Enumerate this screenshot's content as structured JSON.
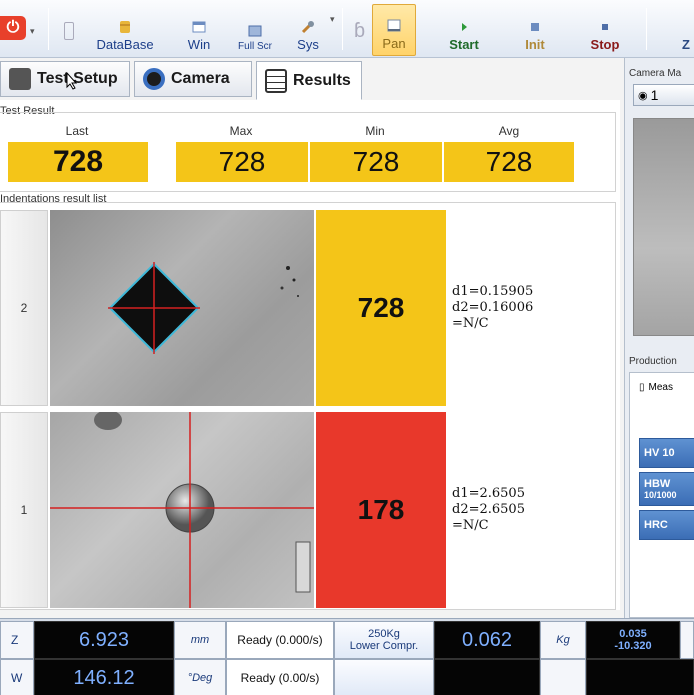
{
  "toolbar": {
    "power_icon": "power-icon",
    "database": "DataBase",
    "win": "Win",
    "fullscr": "Full Scr",
    "sys": "Sys",
    "pan": "Pan",
    "start": "Start",
    "init": "Init",
    "stop": "Stop",
    "z_fragment": "Z"
  },
  "tabs": [
    {
      "label": "Test Setup",
      "icon": "settings-icon"
    },
    {
      "label": "Camera",
      "icon": "camera-icon"
    },
    {
      "label": "Results",
      "icon": "list-icon"
    }
  ],
  "test_result": {
    "title": "Test Result",
    "labels": {
      "last": "Last",
      "max": "Max",
      "min": "Min",
      "avg": "Avg"
    },
    "values": {
      "last": "728",
      "max": "728",
      "min": "728",
      "avg": "728"
    }
  },
  "indentations": {
    "title": "Indentations result list",
    "rows": [
      {
        "index": "2",
        "value": "728",
        "d1": "d1=0.15905",
        "d2": "d2=0.16006",
        "conv": "=N/C",
        "color": "#f4c518"
      },
      {
        "index": "1",
        "value": "178",
        "d1": "d1=2.6505",
        "d2": "d2=2.6505",
        "conv": "=N/C",
        "color": "#e8382b"
      }
    ]
  },
  "right_panel": {
    "camera_title": "Camera Ma",
    "camera_sel": "1",
    "production_title": "Production",
    "meas_label": "Meas",
    "scales": [
      {
        "line1": "HV 10",
        "line2": ""
      },
      {
        "line1": "HBW",
        "line2": "10/1000"
      },
      {
        "line1": "HRC",
        "line2": ""
      }
    ]
  },
  "status": {
    "row1": {
      "axis": "Z",
      "value": "6.923",
      "unit": "mm",
      "state": "Ready (0.000/s)",
      "load1": "250Kg",
      "load2": "Lower Compr.",
      "force": "0.062",
      "force_unit": "Kg",
      "small1": "0.035",
      "small2": "-10.320"
    },
    "row2": {
      "axis": "W",
      "value": "146.12",
      "unit": "°Deg",
      "state": "Ready (0.00/s)"
    }
  }
}
